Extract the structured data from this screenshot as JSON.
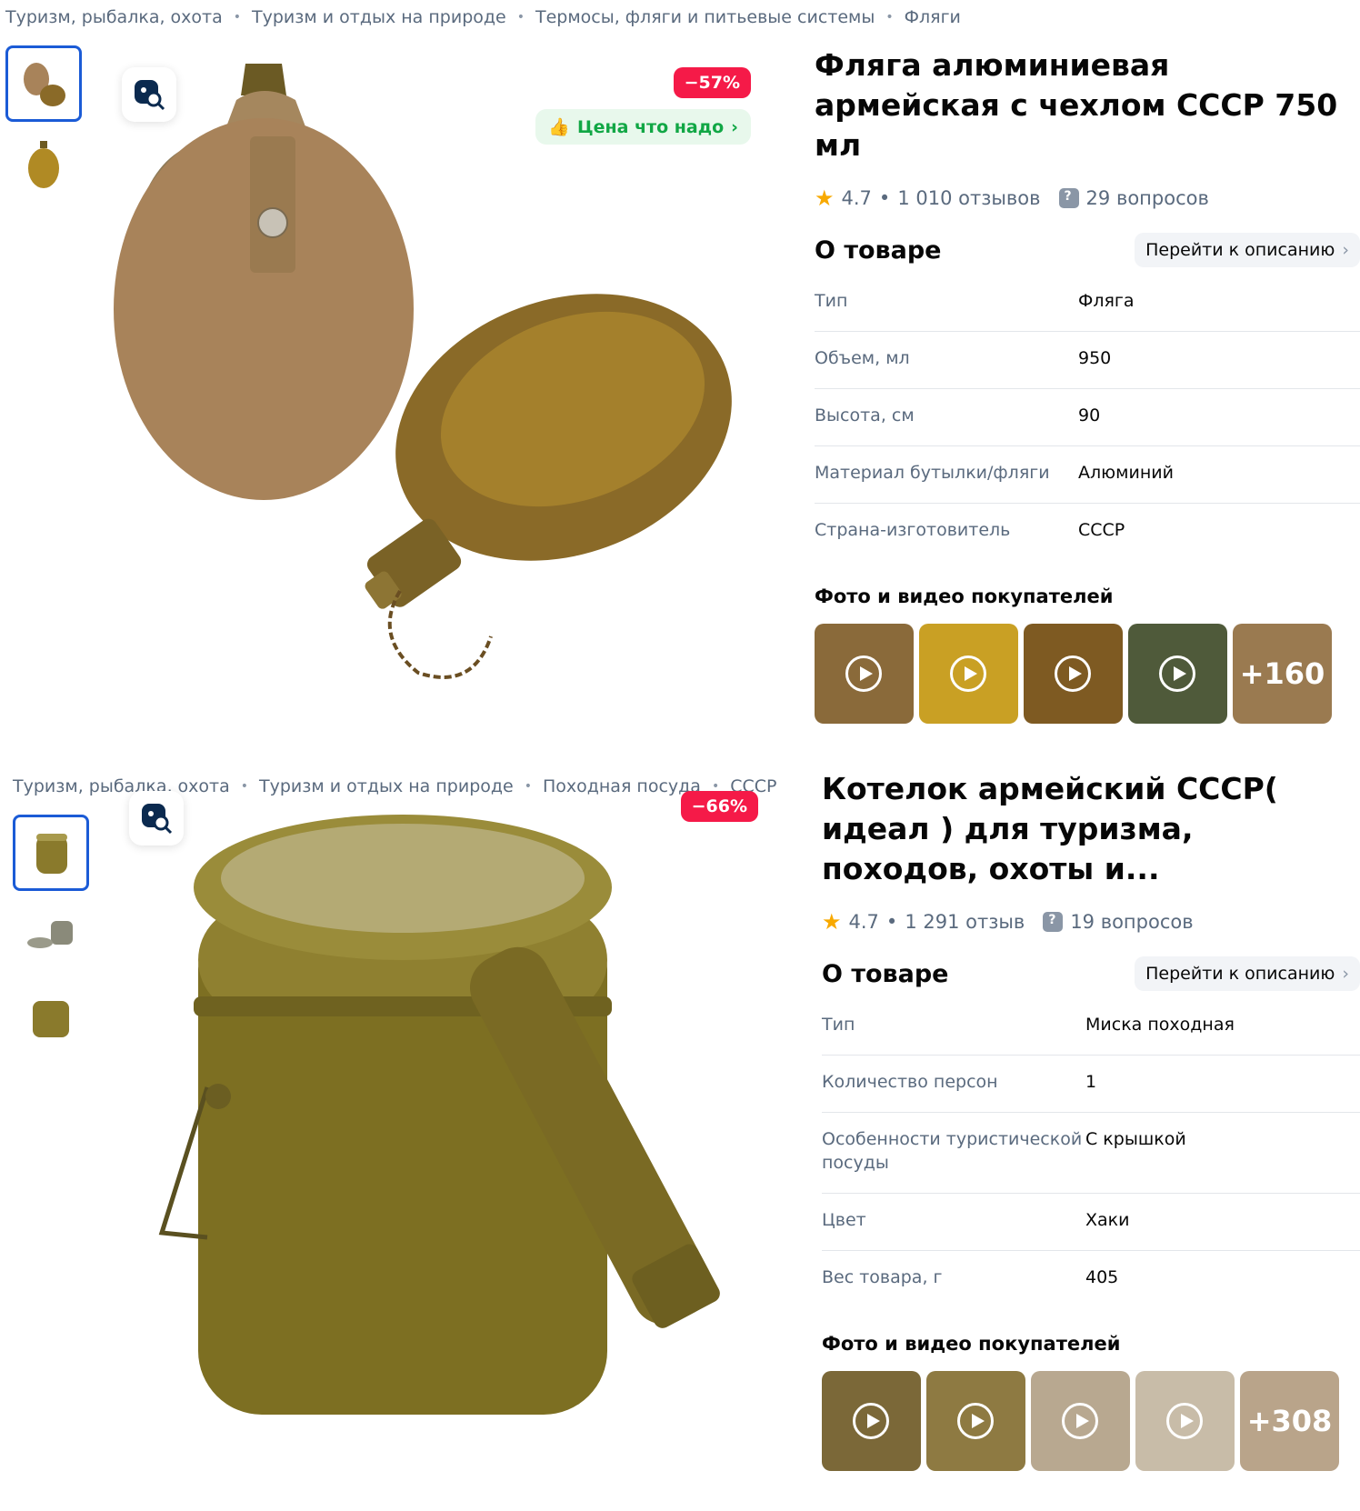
{
  "products": [
    {
      "breadcrumbs": [
        "Туризм, рыбалка, охота",
        "Туризм и отдых на природе",
        "Термосы, фляги и питьевые системы",
        "Фляги"
      ],
      "discount": "−57%",
      "price_badge": "Цена что надо",
      "title": "Фляга алюминиевая армейская с чехлом СССР 750 мл",
      "rating": "4.7",
      "reviews": "1 010 отзывов",
      "questions": "29 вопросов",
      "about_title": "О товаре",
      "to_description": "Перейти к описанию",
      "specs": [
        {
          "k": "Тип",
          "v": "Фляга"
        },
        {
          "k": "Объем, мл",
          "v": "950"
        },
        {
          "k": "Высота, см",
          "v": "90"
        },
        {
          "k": "Материал бутылки/фляги",
          "v": "Алюминий"
        },
        {
          "k": "Страна-изготовитель",
          "v": "СССР"
        }
      ],
      "ugc_title": "Фото и видео покупателей",
      "ugc_more": "+160",
      "ugc_colors": [
        "#8a6a3a",
        "#c9a024",
        "#7e5a22",
        "#4f5a3a",
        "#9a7a50"
      ]
    },
    {
      "breadcrumbs": [
        "Туризм, рыбалка, охота",
        "Туризм и отдых на природе",
        "Походная посуда",
        "СССР"
      ],
      "discount": "−66%",
      "title": "Котелок армейский СССР( идеал ) для туризма, походов, охоты и...",
      "rating": "4.7",
      "reviews": "1 291 отзыв",
      "questions": "19 вопросов",
      "about_title": "О товаре",
      "to_description": "Перейти к описанию",
      "specs": [
        {
          "k": "Тип",
          "v": "Миска походная"
        },
        {
          "k": "Количество персон",
          "v": "1"
        },
        {
          "k": "Особенности туристической посуды",
          "v": "С крышкой"
        },
        {
          "k": "Цвет",
          "v": "Хаки"
        },
        {
          "k": "Вес товара, г",
          "v": "405"
        }
      ],
      "ugc_title": "Фото и видео покупателей",
      "ugc_more": "+308",
      "ugc_colors": [
        "#7b6838",
        "#8e7a42",
        "#b8a890",
        "#c8bca8",
        "#b9a48a"
      ]
    }
  ],
  "colors": {
    "accent_blue": "#1b5bd6",
    "discount_red": "#f51a48",
    "green": "#11a745",
    "khaki": "#8a7a2c",
    "star": "#f8a900"
  }
}
